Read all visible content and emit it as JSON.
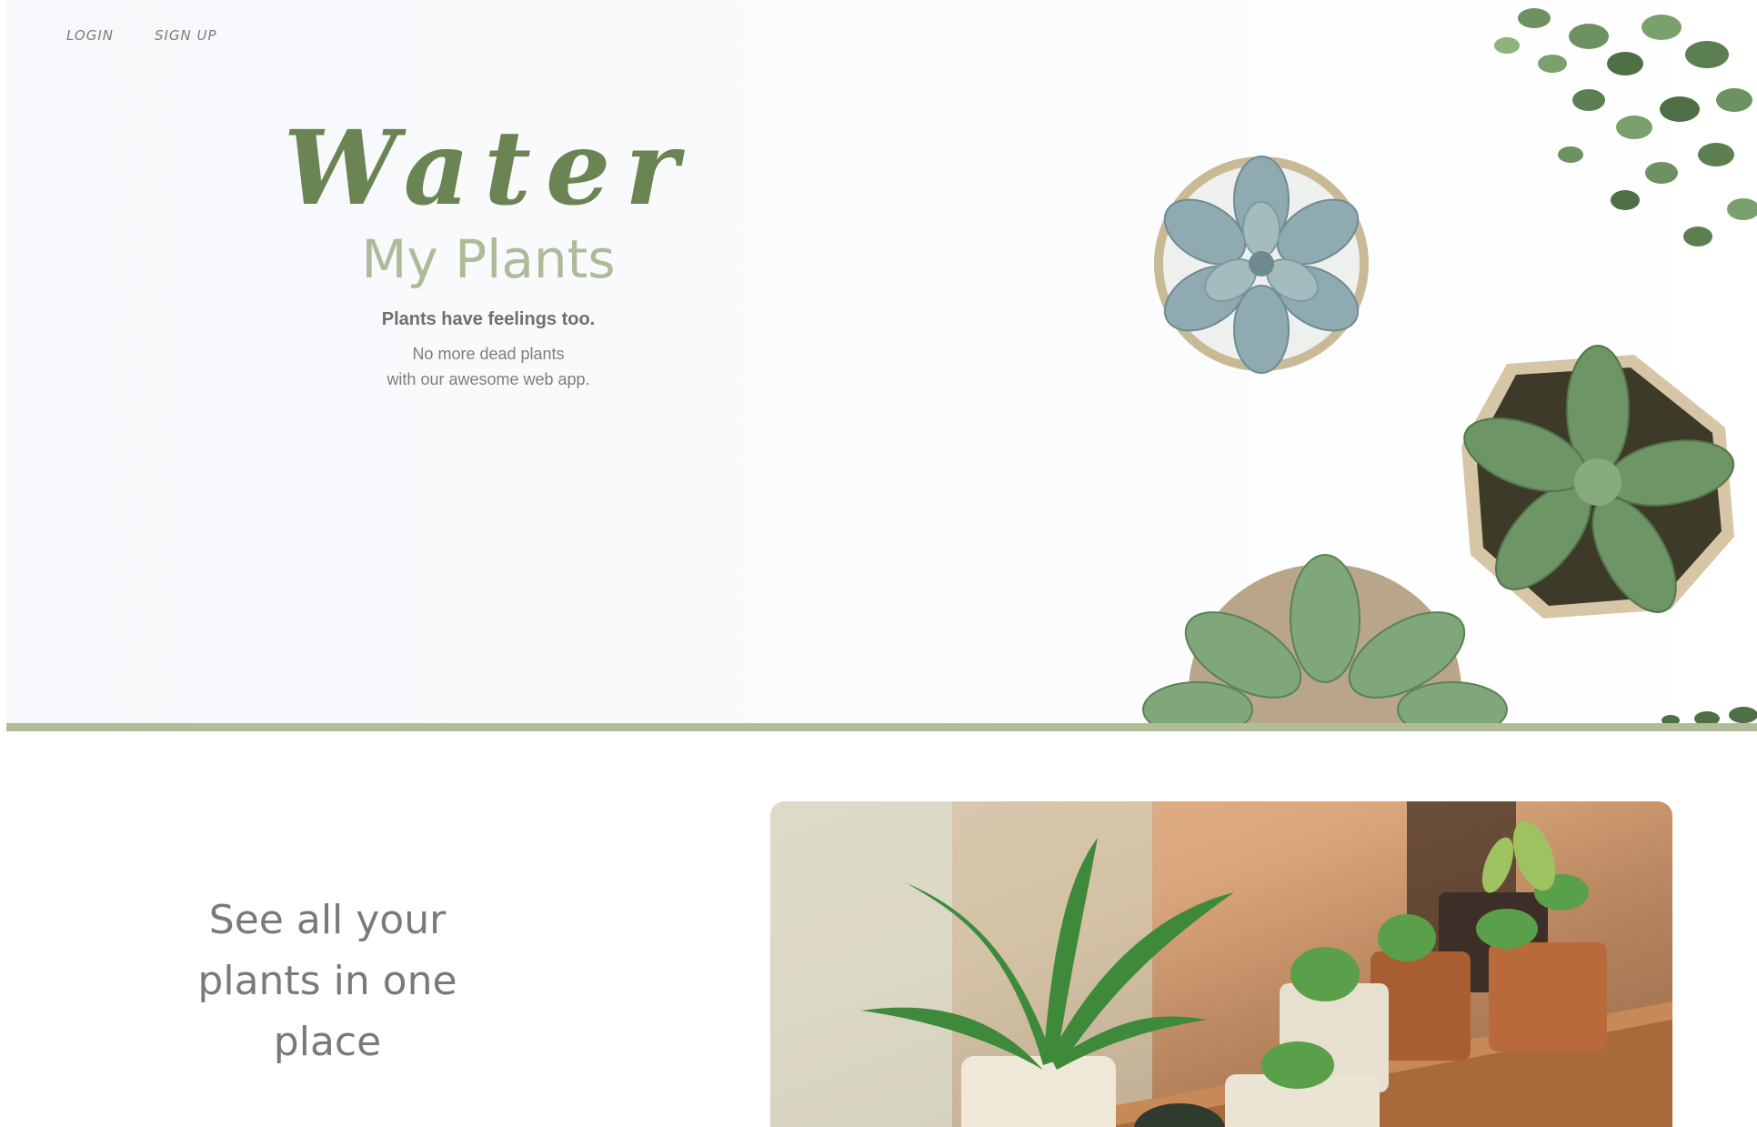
{
  "nav": {
    "login_label": "LOGIN",
    "signup_label": "SIGN UP"
  },
  "hero": {
    "title": "Water",
    "subtitle": "My Plants",
    "tagline_bold": "Plants have feelings too.",
    "tagline_line1": "No more dead plants",
    "tagline_line2": "with our awesome web app."
  },
  "feature": {
    "heading_line1": "See all your",
    "heading_line2": "plants in one",
    "heading_line3": "place"
  },
  "colors": {
    "brand_green": "#6a8553",
    "sage_green": "#aebb98",
    "divider": "#b1bd99"
  }
}
